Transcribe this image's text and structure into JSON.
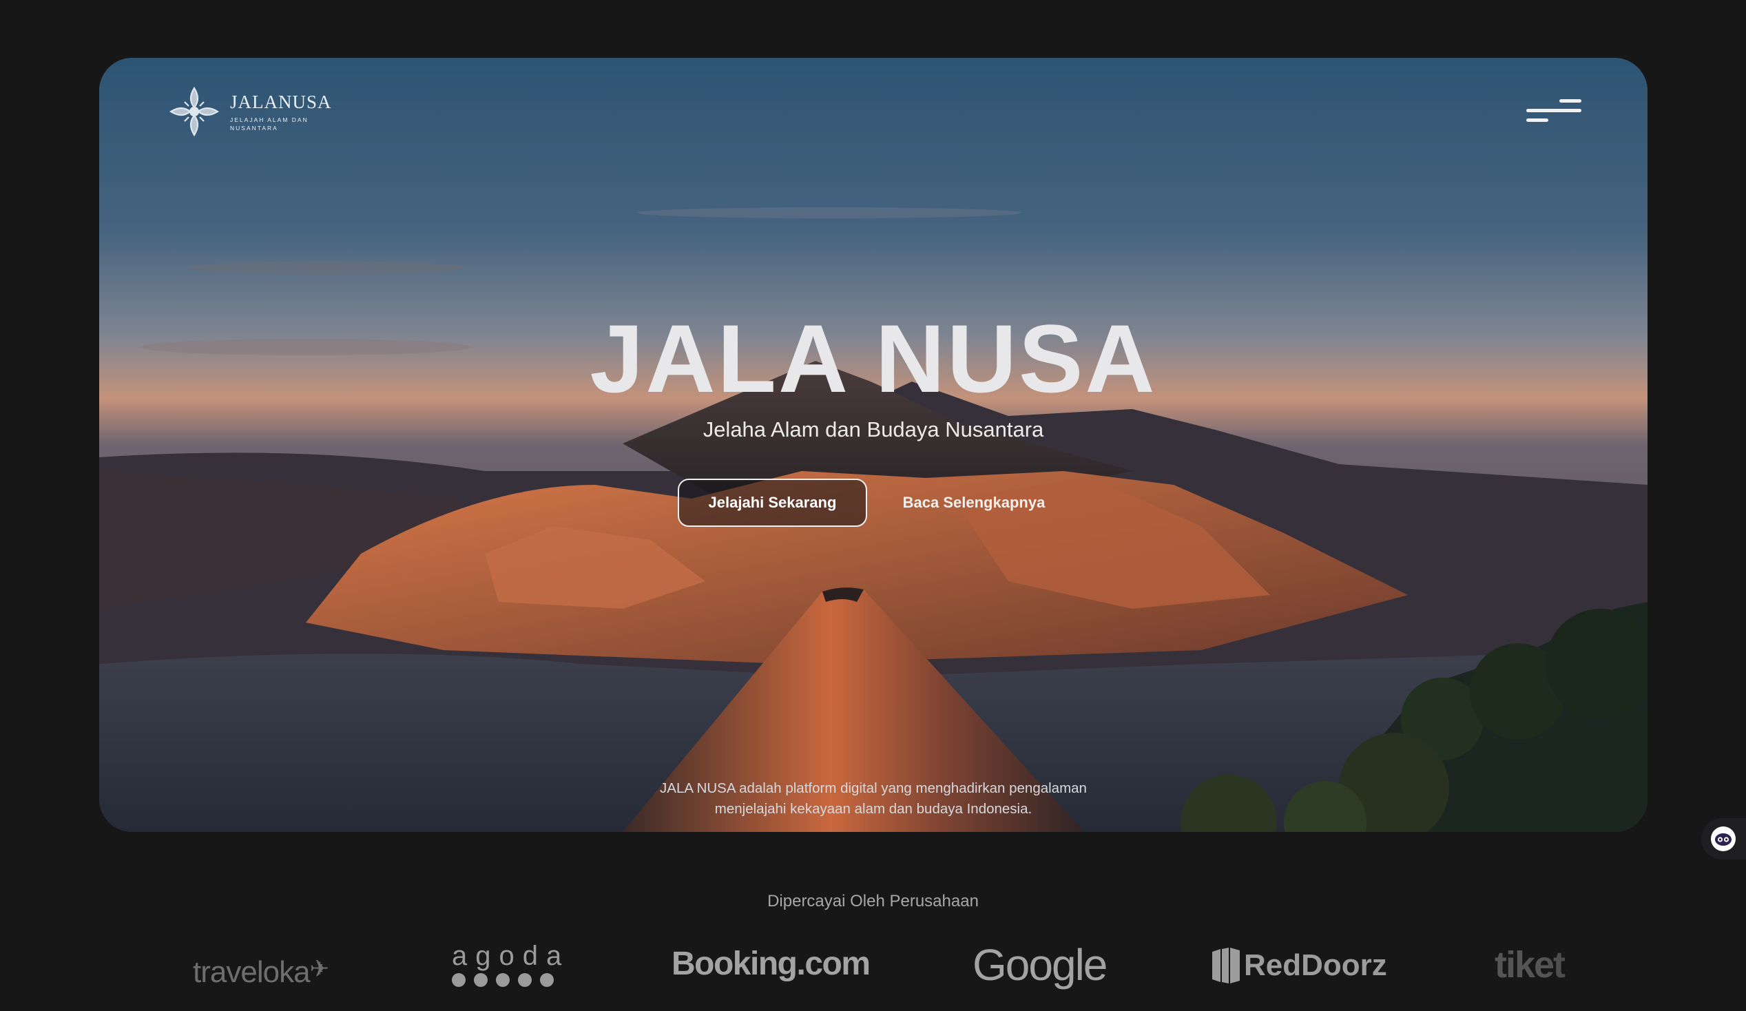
{
  "brand": {
    "name": "JALANUSA",
    "tagline": "JELAJAH ALAM DAN NUSANTARA"
  },
  "hero": {
    "title": "JALA NUSA",
    "subtitle": "Jelaha Alam dan Budaya Nusantara",
    "primary_cta": "Jelajahi Sekarang",
    "secondary_cta": "Baca Selengkapnya",
    "description_line1": "JALA NUSA adalah platform digital yang menghadirkan pengalaman",
    "description_line2": "menjelajahi kekayaan alam dan budaya Indonesia."
  },
  "trusted": {
    "heading": "Dipercayai Oleh Perusahaan",
    "partners": [
      "traveloka",
      "agoda",
      "Booking.com",
      "Google",
      "RedDoorz",
      "tiket"
    ]
  },
  "icons": {
    "logo": "flower-ornament-icon",
    "menu": "hamburger-menu-icon",
    "chat": "chat-bot-icon"
  },
  "colors": {
    "background": "#171717",
    "text_primary": "#e8e8ea",
    "partner_logo": "#9b9b9b"
  }
}
